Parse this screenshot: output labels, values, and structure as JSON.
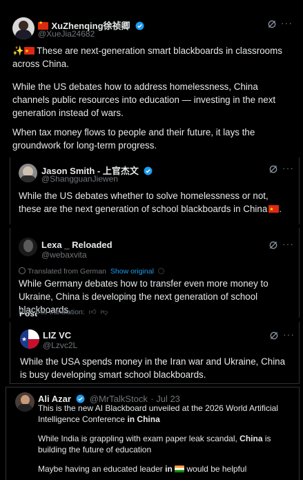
{
  "post1": {
    "name": "XuZhenqing徐祯卿",
    "handle": "@XueJia24682",
    "para1": "These are next-generation smart blackboards in classrooms across China.",
    "para2": "While the US debates how to address homelessness, China channels public resources into education — investing in the next generation instead of wars.",
    "para3": "When tax money flows to people and their future, it lays the groundwork for long-term progress."
  },
  "post2": {
    "name": "Jason Smith - 上官杰文",
    "handle": "@ShangguanJiewen",
    "text": "While the US debates whether to solve homelessness or not, these are the next generation of school blackboards in China"
  },
  "post3": {
    "name": "Lexa _ Reloaded",
    "handle": "@webaxvita",
    "translated_label": "Translated from German",
    "show_original": "Show original",
    "text": "While Germany debates how to transfer even more money to Ukraine, China is developing the next generation of school blackboards.",
    "rate_label": "Rate this translation:",
    "cut_text": "Post"
  },
  "post4": {
    "name": "LIZ VC",
    "handle": "@Lzvc2L",
    "text": "While the USA spends money in the Iran war and Ukraine, China is busy developing smart school blackboards."
  },
  "post5": {
    "name": "Ali Azar",
    "handle": "@MrTalkStock",
    "date": "· Jul 23",
    "line1_pre": "This is the new AI Blackboard unveiled at the 2026 World Artificial Intelligence Conference",
    "line1_bold": "in China",
    "line2_pre": "While India is grappling with exam paper leak scandal,",
    "line2_bold": "China",
    "line2_post": "is building the future of education",
    "line3_pre": "Maybe having an educated leader",
    "line3_bold": "in",
    "line3_post": "would be helpful"
  },
  "icons": {
    "grok": "grok-icon",
    "more": "more-icon",
    "verified": "verified-icon",
    "translate": "translate-icon",
    "settings": "settings-icon",
    "thumbs_up": "thumbs-up-icon",
    "thumbs_down": "thumbs-down-icon"
  },
  "colors": {
    "background": "#000000",
    "text": "#e7e9ea",
    "secondary": "#71767b",
    "accent": "#1d9bf0",
    "border": "#2f3336"
  },
  "more_glyph": "···"
}
